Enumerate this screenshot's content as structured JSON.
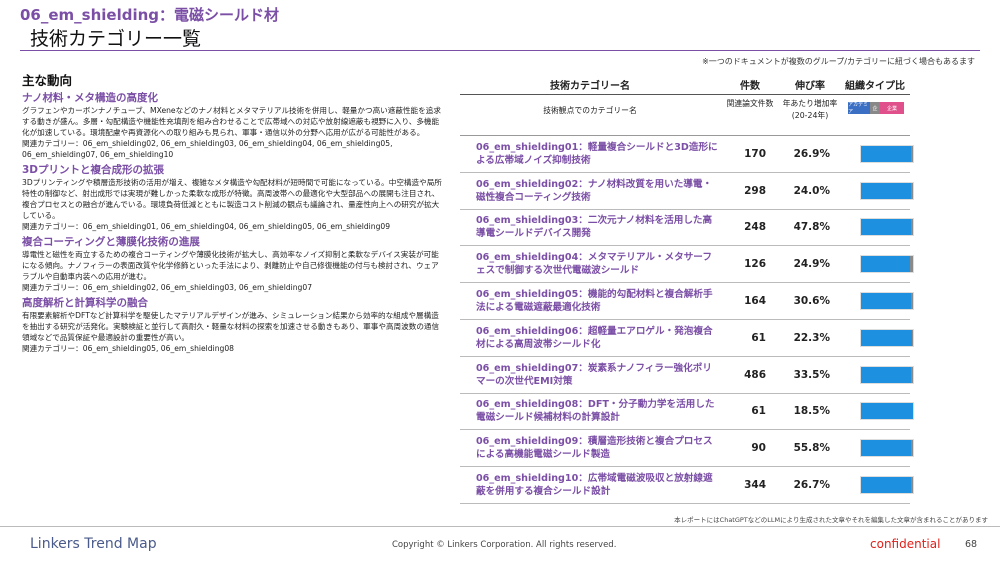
{
  "header": {
    "top_title": "06_em_shielding：電磁シールド材",
    "page_title": "技術カテゴリー一覧",
    "note": "※一つのドキュメントが複数のグループ/カテゴリーに紐づく場合もあるます"
  },
  "left": {
    "heading": "主な動向",
    "topics": [
      {
        "title": "ナノ材料・メタ構造の高度化",
        "body": "グラフェンやカーボンナノチューブ、MXeneなどのナノ材料とメタマテリアル技術を併用し、軽量かつ高い遮蔽性能を追求する動きが盛ん。多層・勾配構造や機能性充填剤を組み合わせることで広帯域への対応や放射線遮蔽も視野に入り、多機能化が加速している。環境配慮や再資源化への取り組みも見られ、軍事・通信以外の分野へ応用が広がる可能性がある。",
        "related": "関連カテゴリー：06_em_shielding02, 06_em_shielding03, 06_em_shielding04, 06_em_shielding05, 06_em_shielding07, 06_em_shielding10"
      },
      {
        "title": "3Dプリントと複合成形の拡張",
        "body": "3Dプリンティングや積層造形技術の活用が増え、複雑なメタ構造や勾配材料が短時間で可能になっている。中空構造や局所特性の制御など、射出成形では実現が難しかった柔軟な成形が特徴。高周波帯への最適化や大型部品への展開も注目され、複合プロセスとの融合が進んでいる。環境負荷低減とともに製造コスト削減の観点も議論され、量産性向上への研究が拡大している。",
        "related": "関連カテゴリー：06_em_shielding01, 06_em_shielding04, 06_em_shielding05, 06_em_shielding09"
      },
      {
        "title": "複合コーティングと薄膜化技術の進展",
        "body": "導電性と磁性を両立するための複合コーティングや薄膜化技術が拡大し、高効率なノイズ抑制と柔軟なデバイス実装が可能になる傾向。ナノフィラーの表面改質や化学修飾といった手法により、剥離防止や自己修復機能の付与も検討され、ウェアラブルや自動車内装への応用が進む。",
        "related": "関連カテゴリー：06_em_shielding02, 06_em_shielding03, 06_em_shielding07"
      },
      {
        "title": "高度解析と計算科学の融合",
        "body": "有限要素解析やDFTなど計算科学を駆使したマテリアルデザインが進み、シミュレーション結果から効率的な組成や層構造を抽出する研究が活発化。実験検証と並行して高耐久・軽量な材料の探索を加速させる動きもあり、軍事や高周波数の通信領域などで品質保証や最適設計の重要性が高い。",
        "related": "関連カテゴリー：06_em_shielding05, 06_em_shielding08"
      }
    ]
  },
  "table": {
    "col_category": "技術カテゴリー名",
    "col_count": "件数",
    "col_growth": "伸び率",
    "col_type": "組織タイプ比",
    "sub_category": "技術観点でのカテゴリー名",
    "sub_count": "関連論文件数",
    "sub_growth": "年あたり増加率(20-24年)",
    "legend": [
      "アカデミア",
      "企",
      "企業"
    ],
    "colors": {
      "academia": "#1e90e0",
      "mixed": "#8a8a8a",
      "corporate": "#e0508a"
    },
    "rows": [
      {
        "name": "06_em_shielding01：軽量複合シールドと3D造形による広帯域ノイズ抑制技術",
        "count": "170",
        "growth": "26.9%",
        "academia": 0.96,
        "mixed": 0.04,
        "corporate": 0.0
      },
      {
        "name": "06_em_shielding02：ナノ材料改質を用いた導電・磁性複合コーティング技術",
        "count": "298",
        "growth": "24.0%",
        "academia": 0.97,
        "mixed": 0.03,
        "corporate": 0.0
      },
      {
        "name": "06_em_shielding03：二次元ナノ材料を活用した高導電シールドデバイス開発",
        "count": "248",
        "growth": "47.8%",
        "academia": 0.97,
        "mixed": 0.03,
        "corporate": 0.0
      },
      {
        "name": "06_em_shielding04：メタマテリアル・メタサーフェスで制御する次世代電磁波シールド",
        "count": "126",
        "growth": "24.9%",
        "academia": 0.95,
        "mixed": 0.05,
        "corporate": 0.0
      },
      {
        "name": "06_em_shielding05：機能的勾配材料と複合解析手法による電磁遮蔽最適化技術",
        "count": "164",
        "growth": "30.6%",
        "academia": 0.97,
        "mixed": 0.03,
        "corporate": 0.0
      },
      {
        "name": "06_em_shielding06：超軽量エアロゲル・発泡複合材による高周波帯シールド化",
        "count": "61",
        "growth": "22.3%",
        "academia": 0.98,
        "mixed": 0.02,
        "corporate": 0.0
      },
      {
        "name": "06_em_shielding07：炭素系ナノフィラー強化ポリマーの次世代EMI対策",
        "count": "486",
        "growth": "33.5%",
        "academia": 0.97,
        "mixed": 0.03,
        "corporate": 0.0
      },
      {
        "name": "06_em_shielding08：DFT・分子動力学を活用した電磁シールド候補材料の計算設計",
        "count": "61",
        "growth": "18.5%",
        "academia": 1.0,
        "mixed": 0.0,
        "corporate": 0.0
      },
      {
        "name": "06_em_shielding09：積層造形技術と複合プロセスによる高機能電磁シールド製造",
        "count": "90",
        "growth": "55.8%",
        "academia": 0.97,
        "mixed": 0.03,
        "corporate": 0.0
      },
      {
        "name": "06_em_shielding10：広帯域電磁波吸収と放射線遮蔽を併用する複合シールド設計",
        "count": "344",
        "growth": "26.7%",
        "academia": 0.96,
        "mixed": 0.04,
        "corporate": 0.0
      }
    ]
  },
  "footer": {
    "ai_note": "本レポートにはChatGPTなどのLLMにより生成された文章やそれを編集した文章が含まれることがあります",
    "logo": "Linkers Trend Map",
    "copyright": "Copyright © Linkers Corporation. All rights reserved.",
    "confidential": "confidential",
    "page": "68"
  }
}
